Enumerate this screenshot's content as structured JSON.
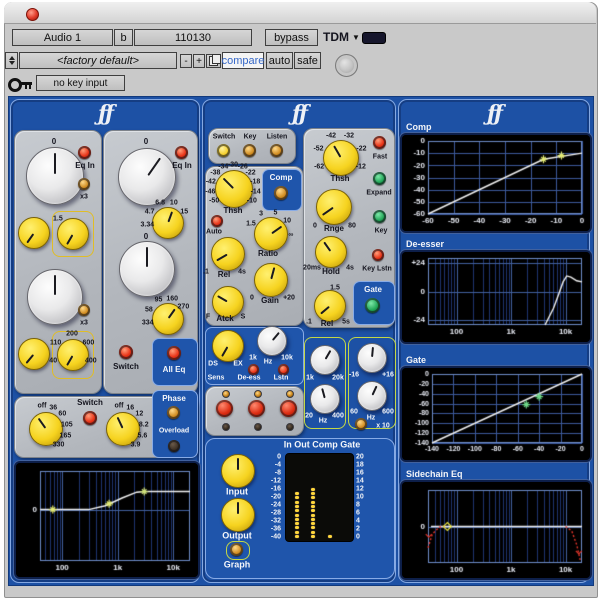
{
  "chrome": {
    "track": "Audio 1",
    "b": "b",
    "insert_id": "110130",
    "bypass": "bypass",
    "tdm": "TDM",
    "preset": "<factory default>",
    "minus": "-",
    "plus": "+",
    "compare": "compare",
    "auto": "auto",
    "safe": "safe",
    "key_input": "no key input"
  },
  "logo": "ƒƒ",
  "eq": {
    "zero": "0",
    "eq_in": "Eq In",
    "x3": "x3",
    "hf_gain_scale": [
      "1.5"
    ],
    "lf_band_scale": [
      "40",
      "110",
      "200",
      "600",
      "400"
    ],
    "hf_freq_scale": [
      "3.34",
      "4.7",
      "6.8",
      "10",
      "15"
    ],
    "mf_freq_scale": [
      "334",
      "58",
      "95",
      "160",
      "270"
    ],
    "switch": "Switch",
    "all_eq": "All Eq",
    "hpf_scale": [
      "off",
      "36",
      "60",
      "105",
      "165",
      "330"
    ],
    "lpf_scale": [
      "off",
      "16",
      "12",
      "8.2",
      "5.6",
      "3.9"
    ],
    "phase": "Phase",
    "overload": "Overload"
  },
  "dyn": {
    "switch": "Switch",
    "key": "Key",
    "listen": "Listen",
    "comp_label": "Comp",
    "thsh": "Thsh",
    "auto": "Auto",
    "comp_thsh_scale": [
      "-50",
      "-46",
      "-42",
      "-38",
      "-34",
      "-30",
      "-26",
      "-22",
      "-18",
      "-14",
      "-10"
    ],
    "ratio": "Ratio",
    "ratio_scale": [
      "1.5",
      "3",
      "5",
      "10",
      "∞"
    ],
    "rel": "Rel",
    "rel_lo": ".1",
    "rel_hi": "4s",
    "gain": "Gain",
    "gain_lo": "0",
    "gain_hi": "+20",
    "atck": "Atck",
    "atck_lo": "F",
    "atck_hi": "S",
    "ds": "DS",
    "ex": "EX",
    "sens": "Sens",
    "de_ess": "De-ess",
    "lstn": "Lstn",
    "deess_lo": "1k",
    "hz": "Hz",
    "deess_hi": "10k",
    "gate_thsh_scale": [
      "-62",
      "-52",
      "-42",
      "-32",
      "-22",
      "-12"
    ],
    "fast": "Fast",
    "expand": "Expand",
    "key2": "Key",
    "key_lstn": "Key Lstn",
    "rnge": "Rnge",
    "rnge_lo": "0",
    "rnge_hi": "80",
    "hold": "Hold",
    "hold_lo": "20ms",
    "hold_hi": "4s",
    "gate_label": "Gate",
    "grel_top": "1.5",
    "grel_lo": ".1",
    "grel": "Rel",
    "grel_hi": "5s",
    "sc1_lo": "1k",
    "sc1_hi": "20k",
    "sc2_lo": "20",
    "sc2_hz": "Hz",
    "sc2_hi": "400",
    "scg_lo": "-16",
    "scg_hi": "+16",
    "sc3_lo": "60",
    "sc3_hi": "600",
    "sc3_hz": "Hz",
    "x10": "x 10"
  },
  "meter": {
    "title": "In Out Comp Gate",
    "input": "Input",
    "output": "Output",
    "graph": "Graph",
    "left_scale": [
      "0",
      "-4",
      "-8",
      "-12",
      "-16",
      "-20",
      "-24",
      "-28",
      "-32",
      "-36",
      "-40"
    ],
    "right_scale": [
      "20",
      "18",
      "16",
      "14",
      "12",
      "10",
      "8",
      "6",
      "4",
      "2",
      "0"
    ],
    "in_dots": 11,
    "out_dots": 12,
    "comp_dots": 1,
    "gate_dots": 0
  },
  "graph_titles": {
    "comp": "Comp",
    "deesser": "De-esser",
    "gate": "Gate",
    "sidechain": "Sidechain Eq"
  },
  "chart_data": {
    "eq_curve": {
      "type": "line",
      "xscale": "log",
      "xmin": 40,
      "xmax": 20000,
      "ymin": -8,
      "ymax": 6,
      "yticks": [
        {
          "v": 0,
          "l": "0"
        }
      ],
      "xticks": [
        {
          "v": 100,
          "l": "100"
        },
        {
          "v": 1000,
          "l": "1k"
        },
        {
          "v": 10000,
          "l": "10k"
        }
      ],
      "series": [
        {
          "color": "#f2f2f2",
          "points": [
            [
              40,
              0
            ],
            [
              300,
              0
            ],
            [
              600,
              0.6
            ],
            [
              1200,
              1.8
            ],
            [
              2200,
              2.7
            ],
            [
              3000,
              2.8
            ],
            [
              20000,
              2.8
            ]
          ]
        }
      ],
      "markers": [
        {
          "x": 68,
          "y": 0,
          "color": "#e4ec74",
          "shape": "star"
        },
        {
          "x": 700,
          "y": 0.9,
          "color": "#e4ec74",
          "shape": "star"
        },
        {
          "x": 3000,
          "y": 2.8,
          "color": "#cfe07a",
          "shape": "star"
        }
      ]
    },
    "comp_curve": {
      "type": "line",
      "xscale": "linear",
      "xmin": -60,
      "xmax": 0,
      "ymin": -60,
      "ymax": 0,
      "yticks": [
        {
          "v": 0,
          "l": "0"
        },
        {
          "v": -10,
          "l": "-10"
        },
        {
          "v": -20,
          "l": "-20"
        },
        {
          "v": -30,
          "l": "-30"
        },
        {
          "v": -40,
          "l": "-40"
        },
        {
          "v": -50,
          "l": "-50"
        },
        {
          "v": -60,
          "l": "-60"
        }
      ],
      "xticks": [
        {
          "v": -60,
          "l": "-60"
        },
        {
          "v": -50,
          "l": "-50"
        },
        {
          "v": -40,
          "l": "-40"
        },
        {
          "v": -30,
          "l": "-30"
        },
        {
          "v": -20,
          "l": "-20"
        },
        {
          "v": -10,
          "l": "-10"
        },
        {
          "v": 0,
          "l": "0"
        }
      ],
      "series": [
        {
          "color": "#f2f2f2",
          "points": [
            [
              -60,
              -60
            ],
            [
              -15,
              -15
            ],
            [
              0,
              -10
            ]
          ]
        }
      ],
      "markers": [
        {
          "x": -15,
          "y": -15,
          "color": "#e4ec74",
          "shape": "star"
        },
        {
          "x": -8,
          "y": -12,
          "color": "#e4ec74",
          "shape": "star"
        }
      ]
    },
    "deesser_curve": {
      "type": "line",
      "xscale": "log",
      "xmin": 30,
      "xmax": 20000,
      "ymin": -28,
      "ymax": 28,
      "yticks": [
        {
          "v": 24,
          "l": "+24"
        },
        {
          "v": 0,
          "l": "0"
        },
        {
          "v": -24,
          "l": "-24"
        }
      ],
      "xticks": [
        {
          "v": 100,
          "l": "100"
        },
        {
          "v": 1000,
          "l": "1k"
        },
        {
          "v": 10000,
          "l": "10k"
        }
      ],
      "series": [
        {
          "color": "#f2f2f2",
          "points": [
            [
              4200,
              -28
            ],
            [
              6000,
              -14
            ],
            [
              7500,
              -2
            ],
            [
              9000,
              8
            ],
            [
              10500,
              13
            ],
            [
              12500,
              12
            ],
            [
              16000,
              9
            ],
            [
              20000,
              8
            ]
          ]
        }
      ],
      "markers": []
    },
    "gate_curve": {
      "type": "line",
      "xscale": "linear",
      "xmin": -140,
      "xmax": 0,
      "ymin": -140,
      "ymax": 0,
      "fs": 7,
      "yticks": [
        {
          "v": 0,
          "l": "0"
        },
        {
          "v": -20,
          "l": "-20"
        },
        {
          "v": -40,
          "l": "-40"
        },
        {
          "v": -60,
          "l": "-60"
        },
        {
          "v": -80,
          "l": "-80"
        },
        {
          "v": -100,
          "l": "-100"
        },
        {
          "v": -120,
          "l": "-120"
        },
        {
          "v": -140,
          "l": "-140"
        }
      ],
      "xticks": [
        {
          "v": -140,
          "l": "-140"
        },
        {
          "v": -120,
          "l": "-120"
        },
        {
          "v": -100,
          "l": "-100"
        },
        {
          "v": -80,
          "l": "-80"
        },
        {
          "v": -60,
          "l": "-60"
        },
        {
          "v": -40,
          "l": "-40"
        },
        {
          "v": -20,
          "l": "-20"
        },
        {
          "v": 0,
          "l": "0"
        }
      ],
      "series": [
        {
          "color": "#f2f2f2",
          "points": [
            [
              -140,
              -140
            ],
            [
              0,
              0
            ]
          ]
        }
      ],
      "markers": [
        {
          "x": -52,
          "y": -62,
          "color": "#6ed888",
          "shape": "star"
        },
        {
          "x": -40,
          "y": -46,
          "color": "#6ed888",
          "shape": "star"
        }
      ]
    },
    "sidechain_curve": {
      "type": "line",
      "xscale": "log",
      "xmin": 30,
      "xmax": 20000,
      "ymin": -24,
      "ymax": 24,
      "yticks": [
        {
          "v": 0,
          "l": "0"
        }
      ],
      "xticks": [
        {
          "v": 100,
          "l": "100"
        },
        {
          "v": 1000,
          "l": "1k"
        },
        {
          "v": 10000,
          "l": "10k"
        }
      ],
      "series": [
        {
          "color": "#f2f2f2",
          "points": [
            [
              34,
              0
            ],
            [
              20000,
              0
            ]
          ]
        },
        {
          "color": "#e0352a",
          "dash": [
            2,
            2
          ],
          "points": [
            [
              30,
              -14
            ],
            [
              36,
              -5
            ],
            [
              48,
              -0.5
            ],
            [
              60,
              0
            ]
          ]
        },
        {
          "color": "#e0352a",
          "dash": [
            2,
            2
          ],
          "points": [
            [
              10000,
              0
            ],
            [
              13000,
              -3
            ],
            [
              16000,
              -12
            ],
            [
              18500,
              -22
            ]
          ]
        }
      ],
      "markers": [
        {
          "x": 68,
          "y": 0,
          "color": "#e8e23c",
          "shape": "diamond"
        },
        {
          "x": 31,
          "y": -7,
          "color": "#e0352a",
          "shape": "tick"
        },
        {
          "x": 17500,
          "y": -18,
          "color": "#e0352a",
          "shape": "tick"
        }
      ]
    }
  }
}
